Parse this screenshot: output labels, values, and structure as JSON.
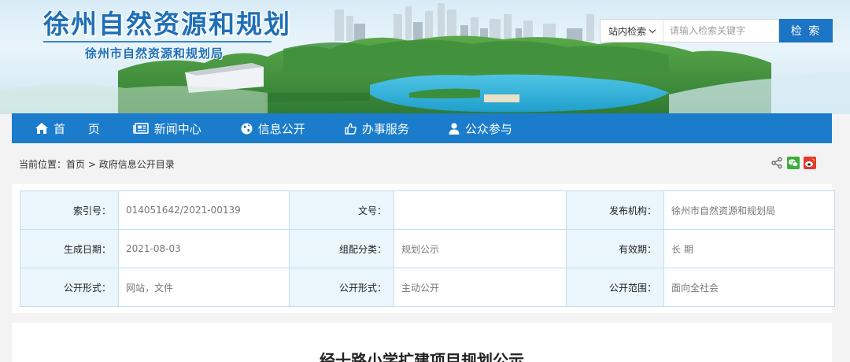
{
  "banner": {
    "title": "徐州自然资源和规划",
    "subtitle": "徐州市自然资源和规划局"
  },
  "search": {
    "scope_label": "站内检索",
    "placeholder": "请输入检索关键字",
    "button_label": "检 索"
  },
  "nav": {
    "items": [
      {
        "label": "首 页",
        "icon": "home-icon"
      },
      {
        "label": "新闻中心",
        "icon": "newspaper-icon"
      },
      {
        "label": "信息公开",
        "icon": "globe-icon"
      },
      {
        "label": "办事服务",
        "icon": "thumbs-up-icon"
      },
      {
        "label": "公众参与",
        "icon": "user-icon"
      }
    ]
  },
  "breadcrumb": {
    "prefix": "当前位置：",
    "home": "首页",
    "separator": " > ",
    "current": "政府信息公开目录"
  },
  "share_icons": [
    "share-icon",
    "wechat-icon",
    "weibo-icon"
  ],
  "info": {
    "rows": [
      [
        {
          "key": "索引号：",
          "value": "014051642/2021-00139"
        },
        {
          "key": "文号：",
          "value": ""
        },
        {
          "key": "发布机构：",
          "value": "徐州市自然资源和规划局"
        }
      ],
      [
        {
          "key": "生成日期：",
          "value": "2021-08-03"
        },
        {
          "key": "组配分类：",
          "value": "规划公示"
        },
        {
          "key": "有效期：",
          "value": "长 期"
        }
      ],
      [
        {
          "key": "公开形式：",
          "value": "网站，文件"
        },
        {
          "key": "公开形式：",
          "value": "主动公开"
        },
        {
          "key": "公开范围：",
          "value": "面向全社会"
        }
      ]
    ]
  },
  "article": {
    "title": "经十路小学扩建项目规划公示"
  },
  "colors": {
    "nav_bg": "#1a7ccb",
    "search_button": "#1c74c4",
    "title_blue": "#1f6fb7",
    "table_key_bg": "#eaf5fc",
    "table_border": "#bfe0ef"
  }
}
